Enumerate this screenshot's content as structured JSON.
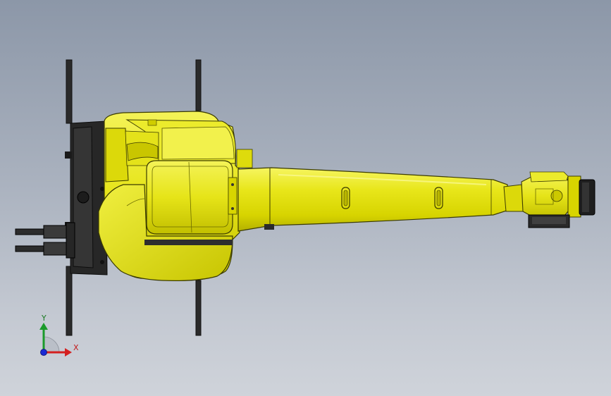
{
  "triad": {
    "x_label": "X",
    "y_label": "Y"
  },
  "colors": {
    "robot_yellow": "#e8e61a",
    "robot_yellow_light": "#f4f35a",
    "robot_yellow_dark": "#b9b600",
    "base_black": "#262626",
    "axis_x": "#d42020",
    "axis_y": "#1a9a2a",
    "axis_z": "#1a2ad4"
  }
}
